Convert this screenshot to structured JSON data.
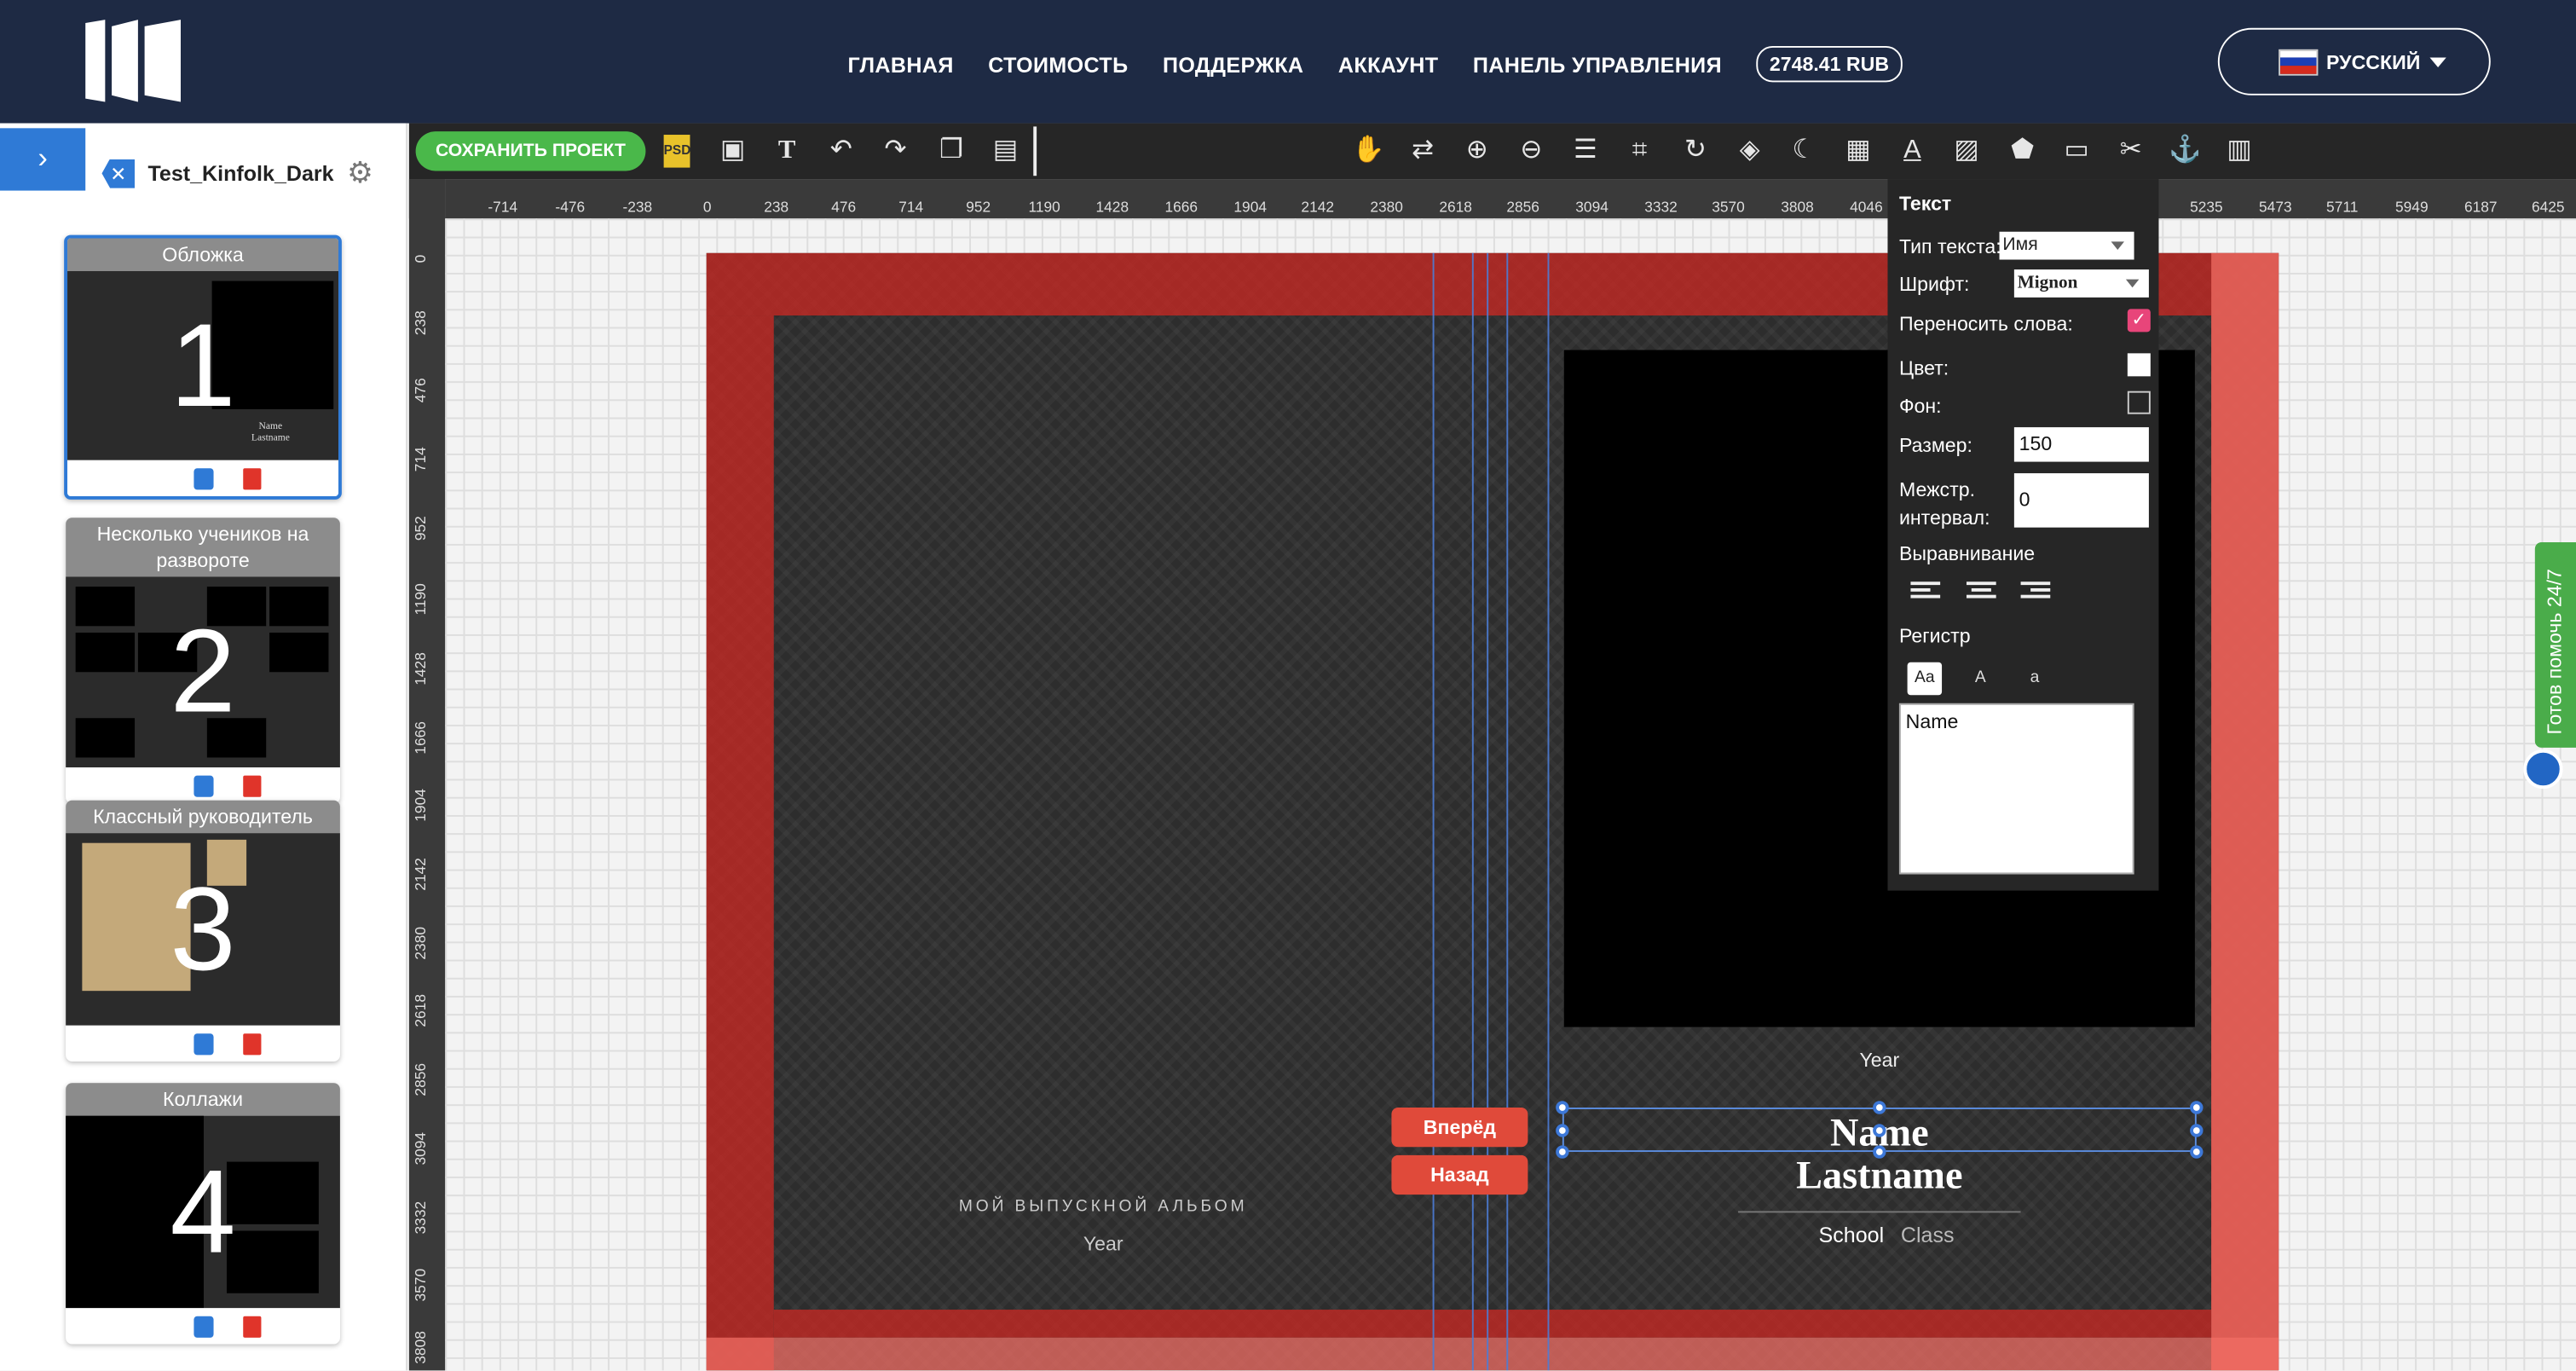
{
  "header": {
    "nav": [
      "ГЛАВНАЯ",
      "СТОИМОСТЬ",
      "ПОДДЕРЖКА",
      "АККАУНТ",
      "ПАНЕЛЬ УПРАВЛЕНИЯ"
    ],
    "balance": "2748.41 RUB",
    "language": "РУССКИЙ"
  },
  "sidebar": {
    "project_name": "Test_Kinfolk_Dark",
    "spreads": [
      {
        "title": "Обложка",
        "number": "1"
      },
      {
        "title": "Несколько учеников на развороте",
        "number": "2"
      },
      {
        "title": "Классный руководитель",
        "number": "3"
      },
      {
        "title": "Коллажи",
        "number": "4"
      }
    ]
  },
  "toolbar": {
    "save_label": "СОХРАНИТЬ ПРОЕКТ"
  },
  "ruler": {
    "h": [
      "-714",
      "-476",
      "-238",
      "0",
      "238",
      "476",
      "714",
      "952",
      "1190",
      "1428",
      "1666",
      "1904",
      "2142",
      "2380",
      "2618",
      "2856",
      "3094",
      "3332",
      "3570",
      "3808",
      "4046",
      "5235",
      "5473",
      "5711",
      "5949",
      "6187",
      "6425"
    ],
    "v": [
      "0",
      "238",
      "476",
      "714",
      "952",
      "1190",
      "1428",
      "1666",
      "1904",
      "2142",
      "2380",
      "2618",
      "2856",
      "3094",
      "3332",
      "3570",
      "3808"
    ]
  },
  "canvas": {
    "year_right": "Year",
    "name": "Name",
    "lastname": "Lastname",
    "school": "School",
    "class": "Class",
    "album_title": "МОЙ ВЫПУСКНОЙ АЛЬБОМ",
    "year_left": "Year",
    "forward_label": "Вперёд",
    "back_label": "Назад",
    "thumb_name": "Name",
    "thumb_lastname": "Lastname"
  },
  "text_panel": {
    "title": "Текст",
    "type_label": "Тип текста:",
    "type_value": "Имя",
    "font_label": "Шрифт:",
    "font_value": "Mignon",
    "wrap_label": "Переносить слова:",
    "wrap_checked": true,
    "color_label": "Цвет:",
    "bg_label": "Фон:",
    "size_label": "Размер:",
    "size_value": "150",
    "spacing_label": "Межстр. интервал:",
    "spacing_value": "0",
    "align_label": "Выравнивание",
    "case_label": "Регистр",
    "case_options": [
      "Aa",
      "A",
      "a"
    ],
    "text_value": "Name"
  },
  "help": {
    "label": "Готов помочь 24/7"
  },
  "colors": {
    "accent": "#2f7ad6",
    "save": "#4ab84a",
    "topbar": "#1e2a44",
    "bleed": "#cd2823",
    "button_red": "#e04a3a"
  }
}
